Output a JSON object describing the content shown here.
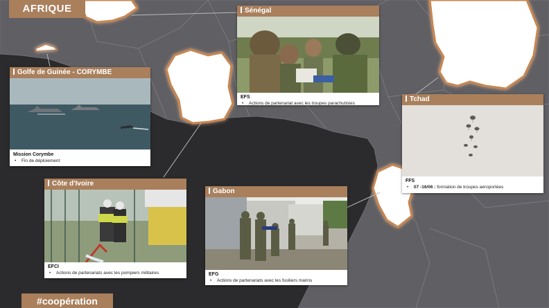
{
  "region_label": "AFRIQUE",
  "hashtag": "#coopération",
  "colors": {
    "accent": "#a97f5c",
    "land": "#5f5f64",
    "sea": "#2b2b2d",
    "highlight": "#ffffff",
    "glow": "#c8864f"
  },
  "cards": {
    "guinee": {
      "title": "Golfe de Guinée - CORYMBE",
      "unit": "Mission Corymbe",
      "bullet": "Fin de déploiement"
    },
    "senegal": {
      "title": "Sénégal",
      "unit": "EFS",
      "bullet": "Actions de partenariat avec les troupes parachutistes"
    },
    "tchad": {
      "title": "Tchad",
      "unit": "FFS",
      "bullet_date": "07 -16/06 :",
      "bullet": "formation de troupes aéroportées"
    },
    "cote_ivoire": {
      "title": "Côte d'Ivoire",
      "unit": "EFCI",
      "bullet": "Actions de partenariats avec les pompiers militaires"
    },
    "gabon": {
      "title": "Gabon",
      "unit": "EFG",
      "bullet": "Actions de partenariats avec les fusiliers marins"
    }
  }
}
